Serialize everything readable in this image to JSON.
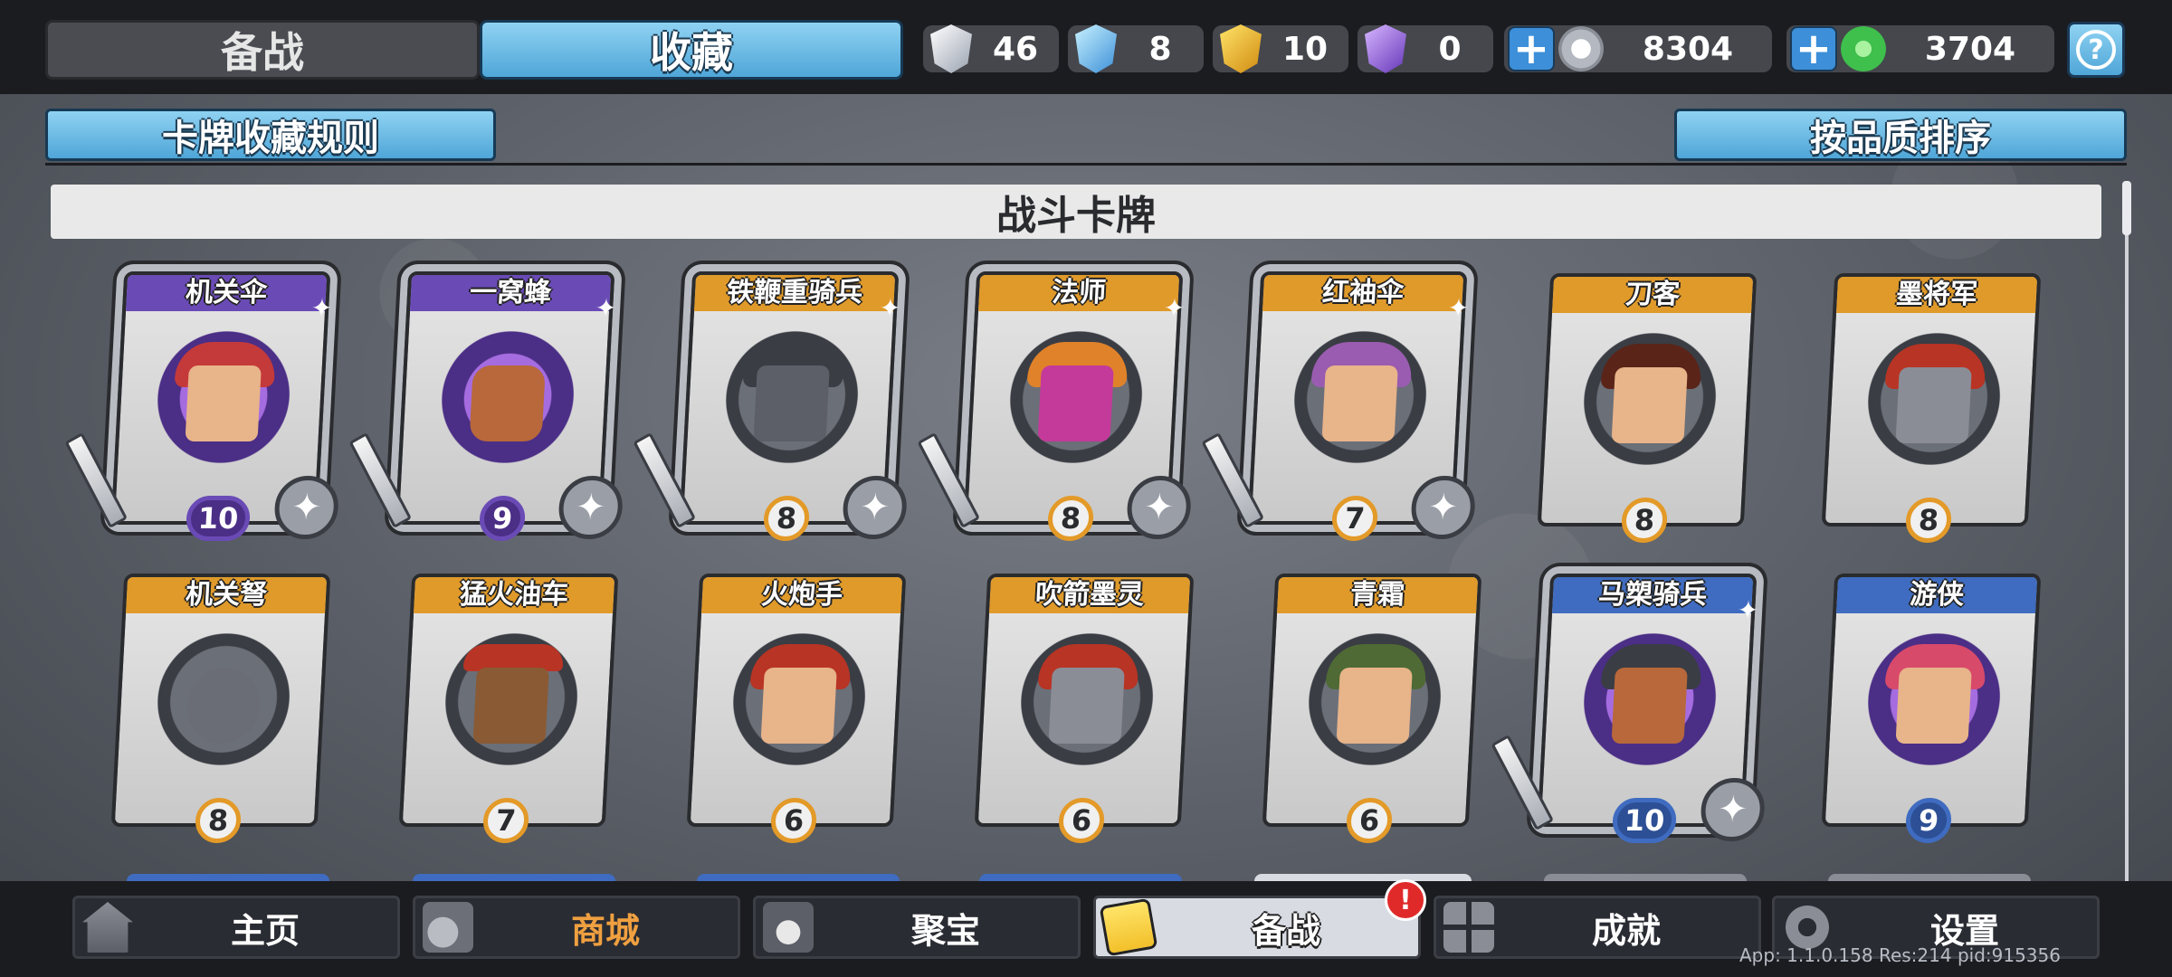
{
  "topbar": {
    "tabs": [
      {
        "label": "备战",
        "active": false
      },
      {
        "label": "收藏",
        "active": true
      }
    ],
    "resources": [
      {
        "icon": "silver-shard-icon",
        "value": "46"
      },
      {
        "icon": "blue-shard-icon",
        "value": "8"
      },
      {
        "icon": "gold-shard-icon",
        "value": "10"
      },
      {
        "icon": "purple-shard-icon",
        "value": "0"
      }
    ],
    "currencies": [
      {
        "icon": "silver-coin-icon",
        "value": "8304"
      },
      {
        "icon": "jade-coin-icon",
        "value": "3704"
      }
    ],
    "help_label": "?"
  },
  "subheader": {
    "rules_label": "卡牌收藏规则",
    "sort_label": "按品质排序"
  },
  "section_title": "战斗卡牌",
  "cards": [
    {
      "name": "机关伞",
      "level": "10",
      "rarity": "purple"
    },
    {
      "name": "一窝蜂",
      "level": "9",
      "rarity": "purple"
    },
    {
      "name": "铁鞭重骑兵",
      "level": "8",
      "rarity": "orange"
    },
    {
      "name": "法师",
      "level": "8",
      "rarity": "orange"
    },
    {
      "name": "红袖伞",
      "level": "7",
      "rarity": "orange"
    },
    {
      "name": "刀客",
      "level": "8",
      "rarity": "orange"
    },
    {
      "name": "墨将军",
      "level": "8",
      "rarity": "orange"
    },
    {
      "name": "机关弩",
      "level": "8",
      "rarity": "orange"
    },
    {
      "name": "猛火油车",
      "level": "7",
      "rarity": "orange"
    },
    {
      "name": "火炮手",
      "level": "6",
      "rarity": "orange"
    },
    {
      "name": "吹箭墨灵",
      "level": "6",
      "rarity": "orange"
    },
    {
      "name": "青霜",
      "level": "6",
      "rarity": "orange"
    },
    {
      "name": "马槊骑兵",
      "level": "10",
      "rarity": "blue"
    },
    {
      "name": "游侠",
      "level": "9",
      "rarity": "blue"
    }
  ],
  "nav": [
    {
      "label": "主页",
      "icon": "home-icon"
    },
    {
      "label": "商城",
      "icon": "shop-icon"
    },
    {
      "label": "聚宝",
      "icon": "treasure-icon"
    },
    {
      "label": "备战",
      "icon": "battle-prep-icon",
      "active": true
    },
    {
      "label": "成就",
      "icon": "achievement-icon"
    },
    {
      "label": "设置",
      "icon": "settings-gear-icon"
    }
  ],
  "alert_badge": "!",
  "footer_info": "App: 1.1.0.158 Res:214 pid:915356",
  "colors": {
    "accent_blue": "#4fa6d8",
    "rarity_purple": "#6a4bb6",
    "rarity_orange": "#e09a2a",
    "rarity_blue": "#3f6cc0",
    "alert_red": "#e02a2a"
  }
}
